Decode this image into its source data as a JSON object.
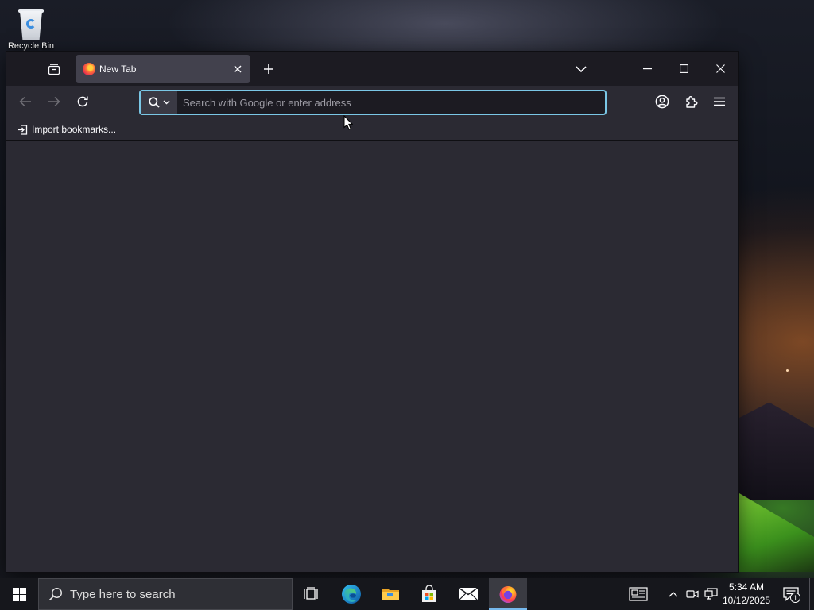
{
  "desktop": {
    "icons": [
      {
        "label": "Recycle Bin",
        "icon": "recycle-bin-icon"
      }
    ]
  },
  "browser": {
    "tabs": [
      {
        "title": "New Tab",
        "favicon": "firefox-icon",
        "active": true
      }
    ],
    "urlbar": {
      "placeholder": "Search with Google or enter address",
      "value": ""
    },
    "bookmarks": {
      "import_label": "Import bookmarks..."
    },
    "colors": {
      "frame": "#1c1b22",
      "toolbar": "#2b2a33",
      "tab_active": "#42414d",
      "focus_ring": "#7ac7e6"
    }
  },
  "taskbar": {
    "search_placeholder": "Type here to search",
    "apps": [
      "task-view-icon",
      "edge-icon",
      "file-explorer-icon",
      "store-icon",
      "mail-icon",
      "firefox-icon"
    ],
    "clock": {
      "time": "5:34 AM",
      "date": "10/12/2025"
    },
    "notification_count": "1"
  }
}
